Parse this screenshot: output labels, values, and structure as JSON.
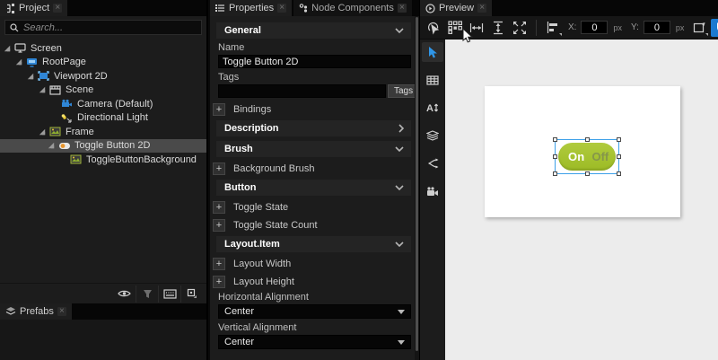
{
  "colors": {
    "accent_blue": "#2f96e8",
    "snap_button_blue": "#1a7ad1",
    "toggle_green": "#a5c32e",
    "toggle_off_text": "#85964a",
    "selection_outline": "#3da0e8",
    "canvas_gray": "#ececec",
    "selected_row_gray": "#4a4a4a"
  },
  "project": {
    "tab_label": "Project",
    "search_placeholder": "Search...",
    "tree": [
      {
        "label": "Screen"
      },
      {
        "label": "RootPage"
      },
      {
        "label": "Viewport 2D"
      },
      {
        "label": "Scene"
      },
      {
        "label": "Camera (Default)"
      },
      {
        "label": "Directional Light"
      },
      {
        "label": "Frame"
      },
      {
        "label": "Toggle Button 2D"
      },
      {
        "label": "ToggleButtonBackground"
      }
    ]
  },
  "prefabs": {
    "tab_label": "Prefabs"
  },
  "properties": {
    "tab_label": "Properties",
    "node_components_tab_label": "Node Components",
    "general": {
      "title": "General",
      "name_label": "Name",
      "name_value": "Toggle Button 2D",
      "tags_label": "Tags",
      "tags_value": "",
      "tags_button_label": "Tags",
      "bindings_label": "Bindings"
    },
    "description": {
      "title": "Description"
    },
    "brush": {
      "title": "Brush",
      "background_brush_label": "Background Brush"
    },
    "button": {
      "title": "Button",
      "toggle_state_label": "Toggle State",
      "toggle_state_count_label": "Toggle State Count"
    },
    "layout_item": {
      "title": "Layout.Item",
      "layout_width_label": "Layout Width",
      "layout_height_label": "Layout Height",
      "horizontal_alignment_label": "Horizontal Alignment",
      "horizontal_alignment_value": "Center",
      "vertical_alignment_label": "Vertical Alignment",
      "vertical_alignment_value": "Center"
    }
  },
  "preview": {
    "tab_label": "Preview",
    "toolbar": {
      "x_label": "X:",
      "x_value": "0",
      "x_unit": "px",
      "y_label": "Y:",
      "y_value": "0",
      "y_unit": "px"
    },
    "canvas": {
      "toggle_on_label": "On",
      "toggle_off_label": "Off"
    }
  }
}
